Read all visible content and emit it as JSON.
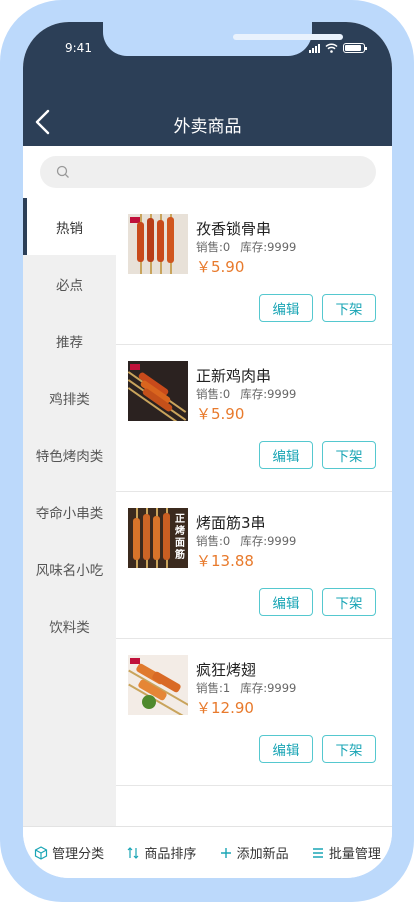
{
  "status": {
    "time": "9:41"
  },
  "header": {
    "title": "外卖商品"
  },
  "search": {
    "placeholder": ""
  },
  "categories": [
    "热销",
    "必点",
    "推荐",
    "鸡排类",
    "特色烤肉类",
    "夺命小串类",
    "风味名小吃",
    "饮料类"
  ],
  "products": [
    {
      "name": "孜香锁骨串",
      "sales": "销售:0",
      "stock": "库存:9999",
      "price": "￥5.90",
      "edit": "编辑",
      "off": "下架"
    },
    {
      "name": "正新鸡肉串",
      "sales": "销售:0",
      "stock": "库存:9999",
      "price": "￥5.90",
      "edit": "编辑",
      "off": "下架"
    },
    {
      "name": "烤面筋3串",
      "sales": "销售:0",
      "stock": "库存:9999",
      "price": "￥13.88",
      "edit": "编辑",
      "off": "下架",
      "image_text": "正烤面筋"
    },
    {
      "name": "疯狂烤翅",
      "sales": "销售:1",
      "stock": "库存:9999",
      "price": "￥12.90",
      "edit": "编辑",
      "off": "下架"
    }
  ],
  "bottom_bar": [
    {
      "label": "管理分类",
      "icon": "cube-icon"
    },
    {
      "label": "商品排序",
      "icon": "sort-icon"
    },
    {
      "label": "添加新品",
      "icon": "plus-icon"
    },
    {
      "label": "批量管理",
      "icon": "list-icon"
    }
  ],
  "colors": {
    "header": "#2c3f57",
    "accent": "#1aa5b5",
    "price": "#e87a2c",
    "frame": "#bcd9fb"
  }
}
